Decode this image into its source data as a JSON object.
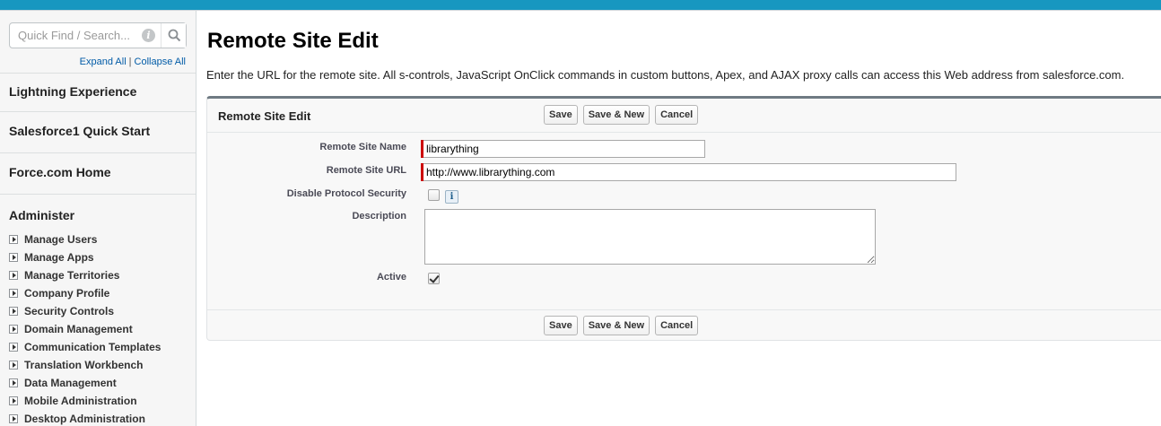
{
  "sidebar": {
    "search_placeholder": "Quick Find / Search...",
    "expand_all": "Expand All",
    "separator": "|",
    "collapse_all": "Collapse All",
    "top_items": [
      {
        "label": "Lightning Experience"
      },
      {
        "label": "Salesforce1 Quick Start"
      },
      {
        "label": "Force.com Home"
      }
    ],
    "administer": {
      "title": "Administer",
      "items": [
        {
          "label": "Manage Users"
        },
        {
          "label": "Manage Apps"
        },
        {
          "label": "Manage Territories"
        },
        {
          "label": "Company Profile"
        },
        {
          "label": "Security Controls"
        },
        {
          "label": "Domain Management"
        },
        {
          "label": "Communication Templates"
        },
        {
          "label": "Translation Workbench"
        },
        {
          "label": "Data Management"
        },
        {
          "label": "Mobile Administration"
        },
        {
          "label": "Desktop Administration"
        }
      ]
    }
  },
  "main": {
    "title": "Remote Site Edit",
    "description": "Enter the URL for the remote site. All s-controls, JavaScript OnClick commands in custom buttons, Apex, and AJAX proxy calls can access this Web address from salesforce.com.",
    "panel": {
      "title": "Remote Site Edit",
      "buttons": {
        "save": "Save",
        "save_new": "Save & New",
        "cancel": "Cancel"
      },
      "fields": {
        "remote_site_name": {
          "label": "Remote Site Name",
          "value": "librarything"
        },
        "remote_site_url": {
          "label": "Remote Site URL",
          "value": "http://www.librarything.com"
        },
        "disable_protocol_security": {
          "label": "Disable Protocol Security",
          "checked": false,
          "info_icon": "i"
        },
        "description": {
          "label": "Description",
          "value": ""
        },
        "active": {
          "label": "Active",
          "checked": true
        }
      }
    }
  },
  "colors": {
    "topbar": "#1797c0",
    "required": "#cc0000",
    "link": "#015ba7"
  }
}
